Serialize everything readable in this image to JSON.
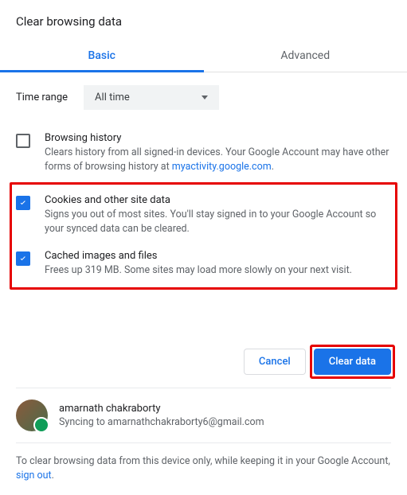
{
  "title": "Clear browsing data",
  "tabs": {
    "basic": "Basic",
    "advanced": "Advanced"
  },
  "time_range": {
    "label": "Time range",
    "value": "All time"
  },
  "items": {
    "history": {
      "title": "Browsing history",
      "desc_pre": "Clears history from all signed-in devices. Your Google Account may have other forms of browsing history at ",
      "link": "myactivity.google.com",
      "desc_post": "."
    },
    "cookies": {
      "title": "Cookies and other site data",
      "desc": "Signs you out of most sites. You'll stay signed in to your Google Account so your synced data can be cleared."
    },
    "cache": {
      "title": "Cached images and files",
      "desc": "Frees up 319 MB. Some sites may load more slowly on your next visit."
    }
  },
  "buttons": {
    "cancel": "Cancel",
    "clear": "Clear data"
  },
  "account": {
    "name": "amarnath chakraborty",
    "sync": "Syncing to amarnathchakraborty6@gmail.com"
  },
  "footer": {
    "pre": "To clear browsing data from this device only, while keeping it in your Google Account, ",
    "link": "sign out",
    "post": "."
  }
}
